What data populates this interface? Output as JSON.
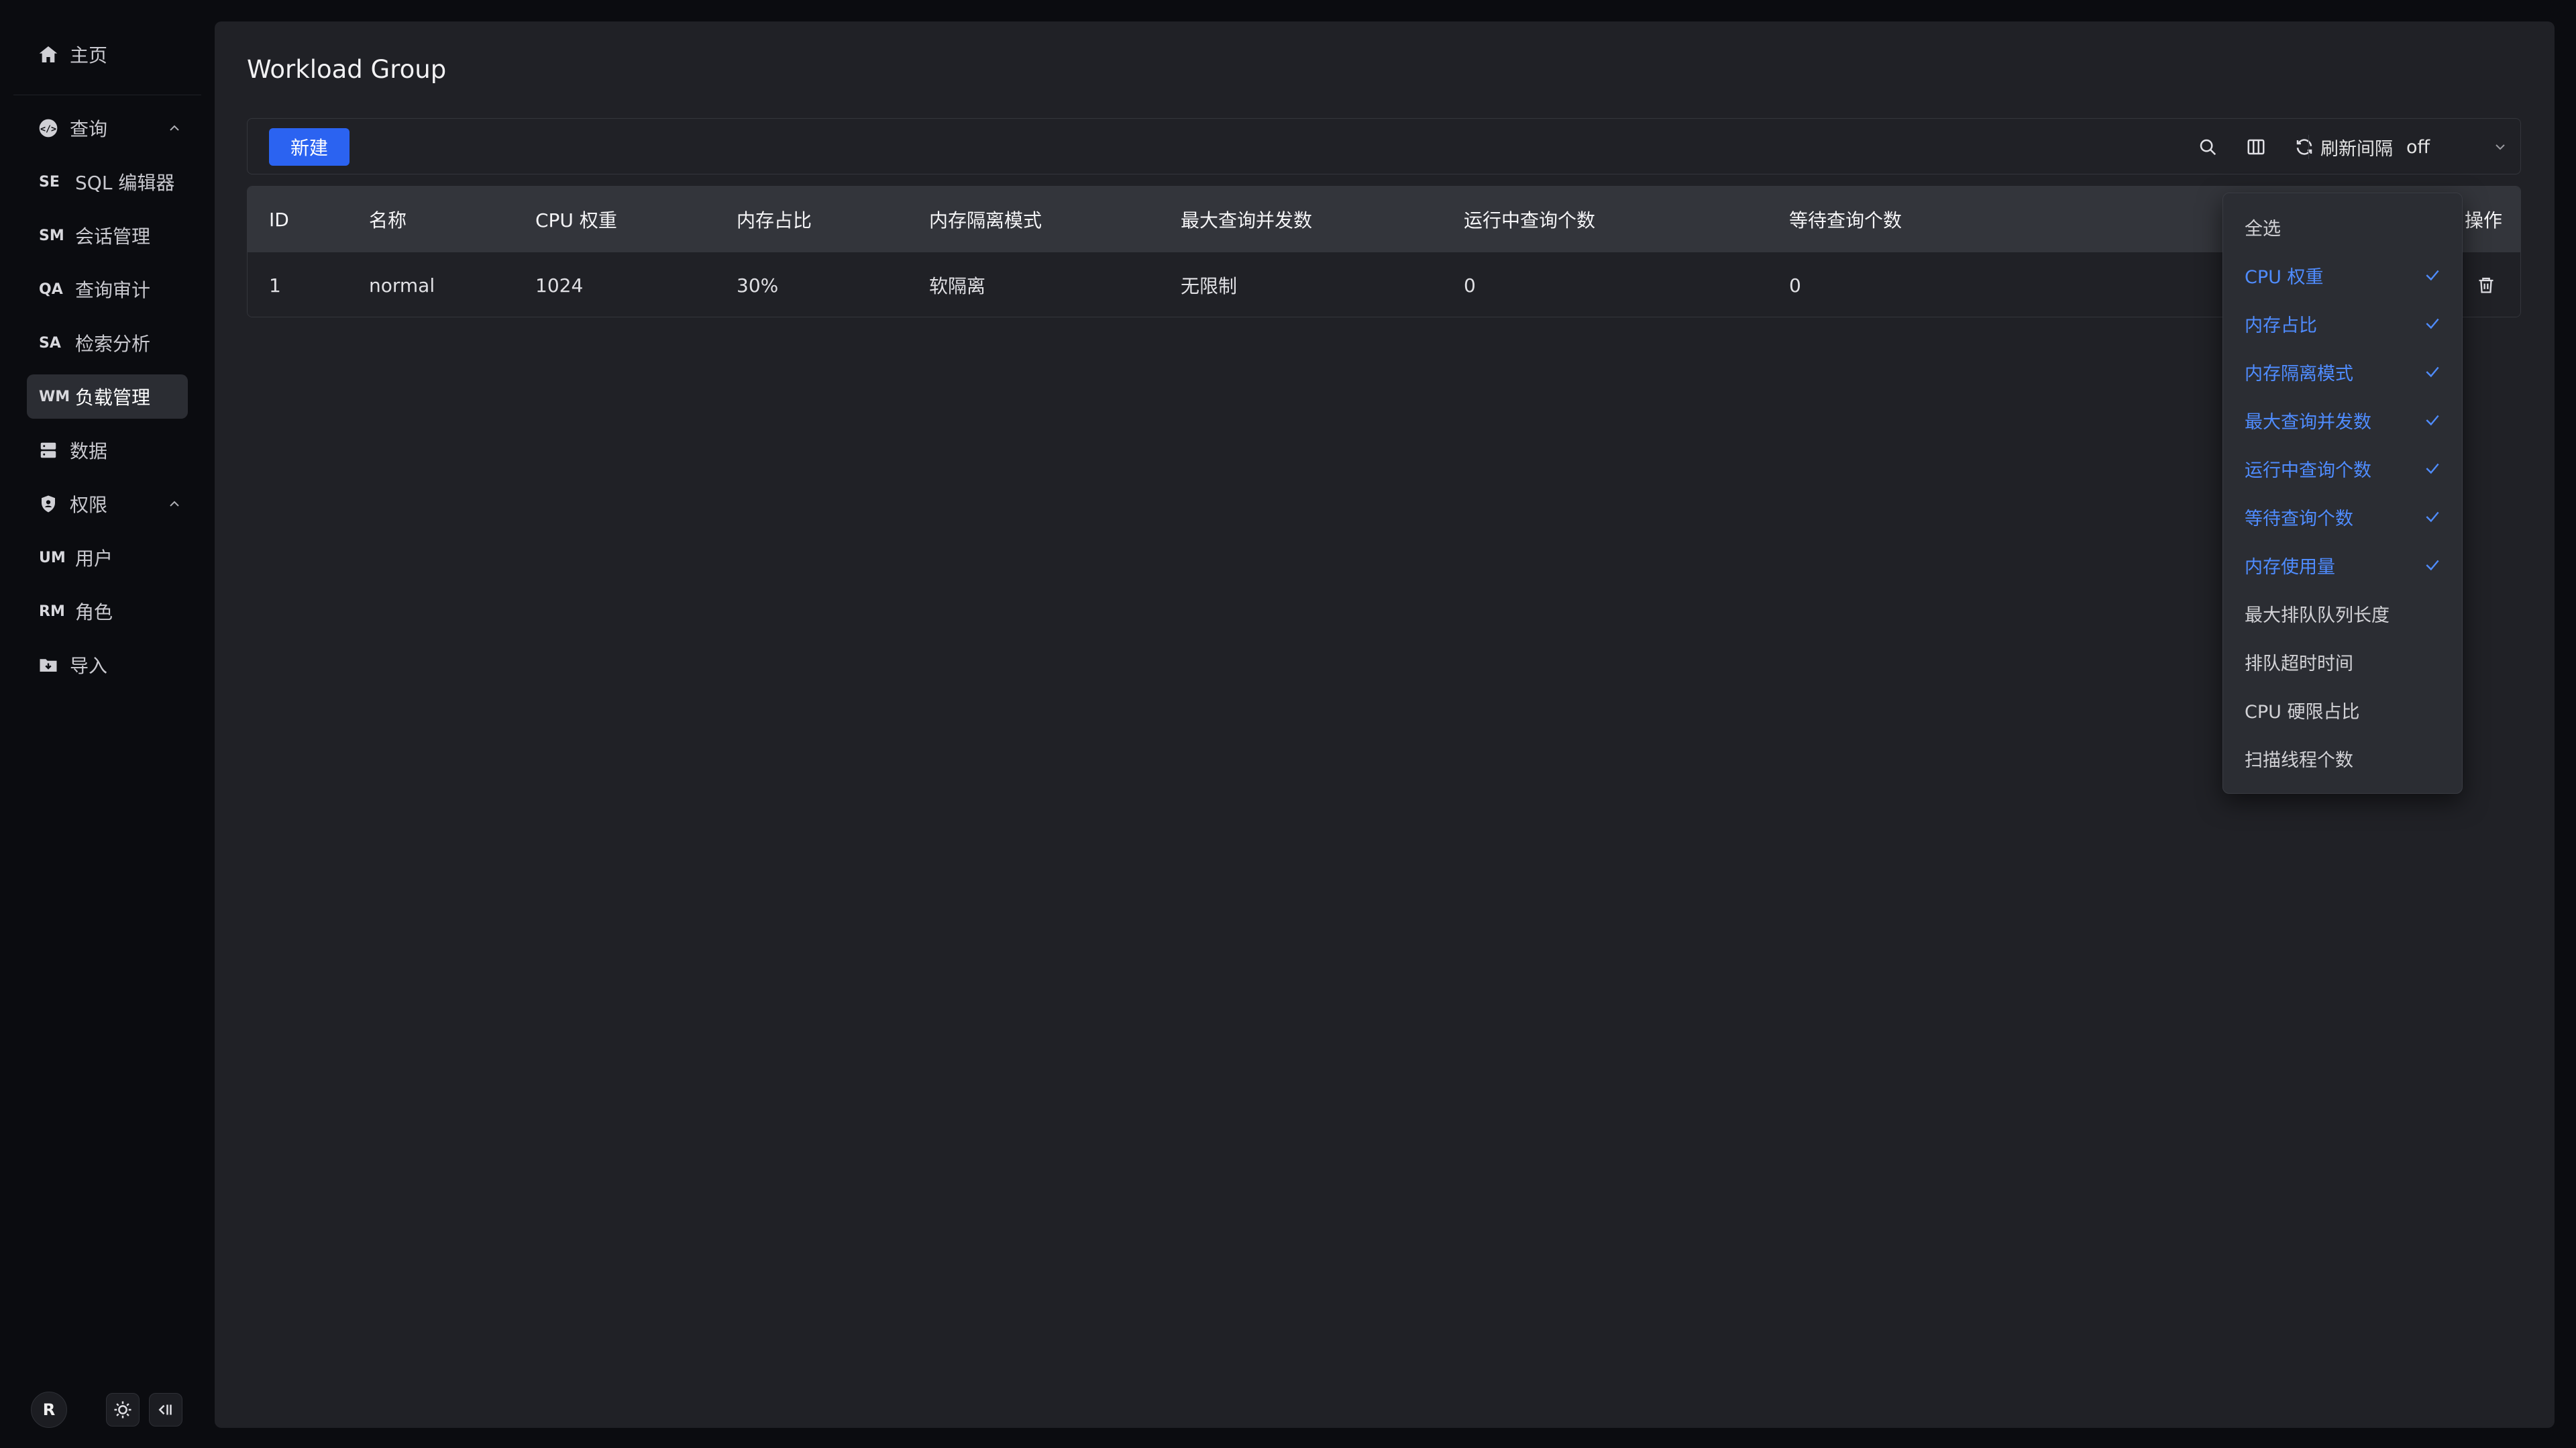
{
  "sidebar": {
    "home": "主页",
    "query_group": "查询",
    "query_items": [
      {
        "code": "SE",
        "label": "SQL 编辑器"
      },
      {
        "code": "SM",
        "label": "会话管理"
      },
      {
        "code": "QA",
        "label": "查询审计"
      },
      {
        "code": "SA",
        "label": "检索分析"
      },
      {
        "code": "WM",
        "label": "负载管理"
      }
    ],
    "data": "数据",
    "perm_group": "权限",
    "perm_items": [
      {
        "code": "UM",
        "label": "用户"
      },
      {
        "code": "RM",
        "label": "角色"
      }
    ],
    "import": "导入",
    "avatar_initial": "R"
  },
  "page": {
    "title": "Workload Group"
  },
  "toolbar": {
    "new_label": "新建",
    "refresh_label": "刷新间隔",
    "refresh_value": "off"
  },
  "table": {
    "headers": [
      "ID",
      "名称",
      "CPU 权重",
      "内存占比",
      "内存隔离模式",
      "最大查询并发数",
      "运行中查询个数",
      "等待查询个数",
      "操作"
    ],
    "rows": [
      [
        "1",
        "normal",
        "1024",
        "30%",
        "软隔离",
        "无限制",
        "0",
        "0"
      ]
    ]
  },
  "column_menu": {
    "items": [
      {
        "label": "全选",
        "checked": false
      },
      {
        "label": "CPU 权重",
        "checked": true
      },
      {
        "label": "内存占比",
        "checked": true
      },
      {
        "label": "内存隔离模式",
        "checked": true
      },
      {
        "label": "最大查询并发数",
        "checked": true
      },
      {
        "label": "运行中查询个数",
        "checked": true
      },
      {
        "label": "等待查询个数",
        "checked": true
      },
      {
        "label": "内存使用量",
        "checked": true
      },
      {
        "label": "最大排队队列长度",
        "checked": false
      },
      {
        "label": "排队超时时间",
        "checked": false
      },
      {
        "label": "CPU 硬限占比",
        "checked": false
      },
      {
        "label": "扫描线程个数",
        "checked": false
      }
    ]
  },
  "colors": {
    "accent": "#2b63f1",
    "checked_text": "#4f8cff",
    "background": "#0b0c10",
    "panel": "#202126",
    "table_header": "#33353b"
  }
}
